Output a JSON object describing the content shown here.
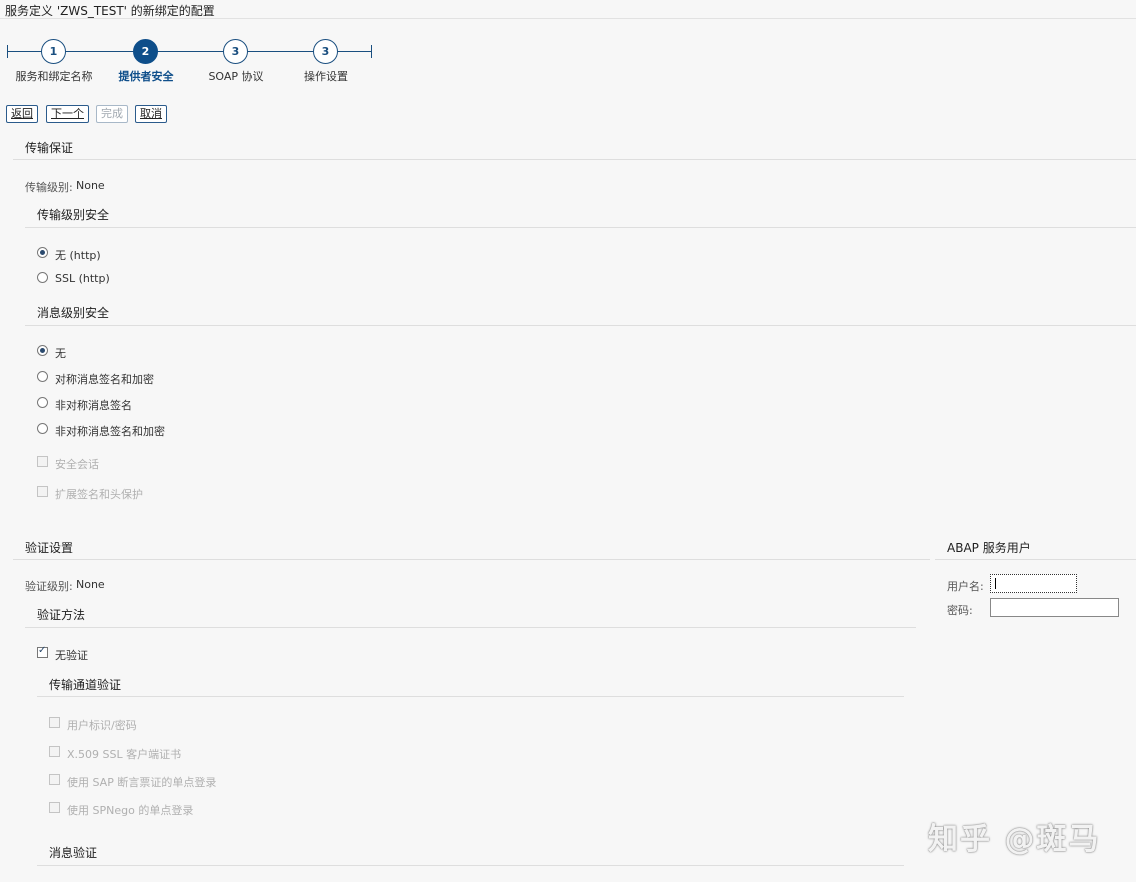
{
  "window": {
    "title": "服务定义 'ZWS_TEST' 的新绑定的配置"
  },
  "roadmap": {
    "steps": [
      {
        "number": "1",
        "label": "服务和绑定名称",
        "active": false
      },
      {
        "number": "2",
        "label": "提供者安全",
        "active": true
      },
      {
        "number": "3",
        "label": "SOAP 协议",
        "active": false
      },
      {
        "number": "3",
        "label": "操作设置",
        "active": false
      }
    ]
  },
  "toolbar": {
    "back": "返回",
    "next": "下一个",
    "finish": "完成",
    "cancel": "取消"
  },
  "transport": {
    "header": "传输保证",
    "level_label": "传输级别:",
    "level_value": "None",
    "level_security": {
      "header": "传输级别安全",
      "options": [
        {
          "label": "无 (http)",
          "selected": true
        },
        {
          "label": "SSL (http)",
          "selected": false
        }
      ]
    },
    "message_security": {
      "header": "消息级别安全",
      "options": [
        {
          "label": "无",
          "selected": true
        },
        {
          "label": "对称消息签名和加密",
          "selected": false
        },
        {
          "label": "非对称消息签名",
          "selected": false
        },
        {
          "label": "非对称消息签名和加密",
          "selected": false
        }
      ],
      "checkboxes": [
        {
          "label": "安全会话",
          "checked": false,
          "disabled": true
        },
        {
          "label": "扩展签名和头保护",
          "checked": false,
          "disabled": true
        }
      ]
    }
  },
  "auth": {
    "header": "验证设置",
    "level_label": "验证级别:",
    "level_value": "None",
    "method": {
      "header": "验证方法",
      "no_auth_label": "无验证",
      "no_auth_checked": true
    },
    "channel": {
      "header": "传输通道验证",
      "checkboxes": [
        {
          "label": "用户标识/密码",
          "disabled": true
        },
        {
          "label": "X.509 SSL 客户端证书",
          "disabled": true
        },
        {
          "label": "使用 SAP 断言票证的单点登录",
          "disabled": true
        },
        {
          "label": "使用 SPNego 的单点登录",
          "disabled": true
        }
      ]
    },
    "message": {
      "header": "消息验证"
    }
  },
  "abap_user": {
    "header": "ABAP 服务用户",
    "username_label": "用户名:",
    "username_value": "",
    "password_label": "密码:",
    "password_value": ""
  },
  "watermark": "知乎 @斑马"
}
